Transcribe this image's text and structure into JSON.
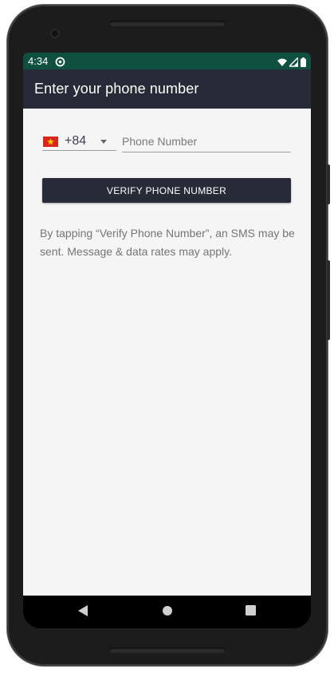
{
  "status_bar": {
    "time": "4:34",
    "notification_icon": "data-saver-icon",
    "wifi_icon": "wifi-icon",
    "signal_icon": "signal-icon",
    "battery_icon": "battery-icon",
    "background_color": "#0f5040"
  },
  "app_bar": {
    "title": "Enter your phone number",
    "background_color": "#272b37"
  },
  "form": {
    "country": {
      "flag_icon": "vietnam-flag-icon",
      "code": "+84"
    },
    "phone_input": {
      "value": "",
      "placeholder": "Phone Number"
    },
    "verify_button_label": "VERIFY PHONE NUMBER",
    "disclaimer": "By tapping “Verify Phone Number”, an SMS may be sent. Message & data rates may apply."
  },
  "nav_bar": {
    "back_icon": "back-triangle-icon",
    "home_icon": "home-circle-icon",
    "recents_icon": "recents-square-icon"
  }
}
